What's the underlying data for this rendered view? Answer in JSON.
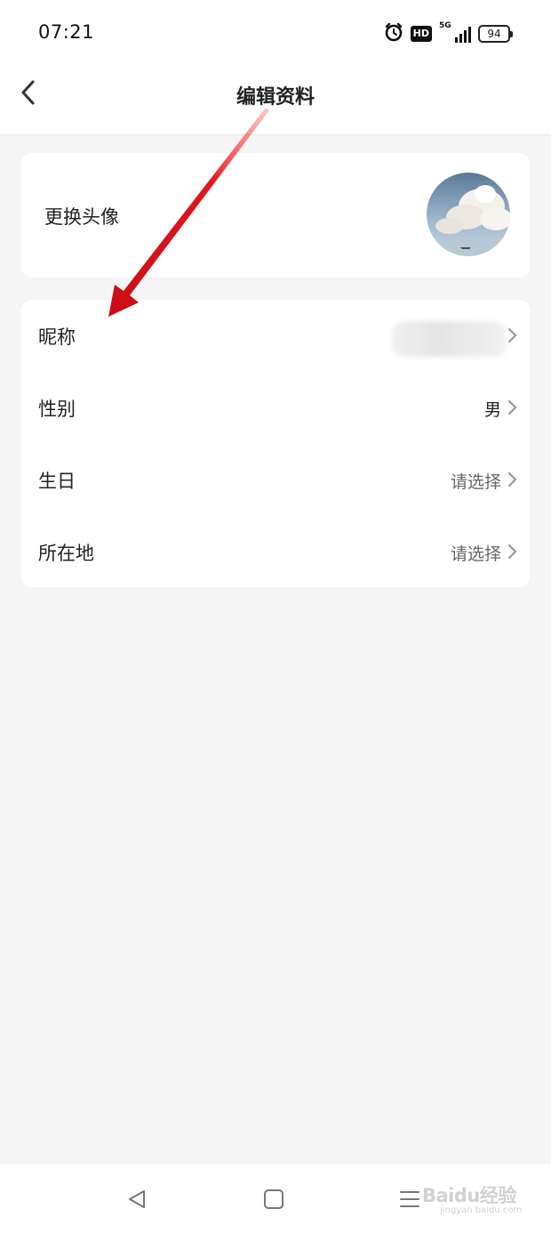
{
  "status_bar": {
    "time": "07:21",
    "network": "5G",
    "hd_badge": "HD",
    "battery": "94"
  },
  "header": {
    "title": "编辑资料"
  },
  "avatar_section": {
    "label": "更换头像"
  },
  "profile_rows": [
    {
      "label": "昵称",
      "value": ""
    },
    {
      "label": "性别",
      "value": "男"
    },
    {
      "label": "生日",
      "value": "请选择"
    },
    {
      "label": "所在地",
      "value": "请选择"
    }
  ],
  "watermark": {
    "brand": "Baidu经验",
    "sub": "jingyan.baidu.com"
  },
  "colors": {
    "background": "#f5f5f5",
    "card": "#ffffff",
    "annotation_arrow": "#e0141b"
  }
}
